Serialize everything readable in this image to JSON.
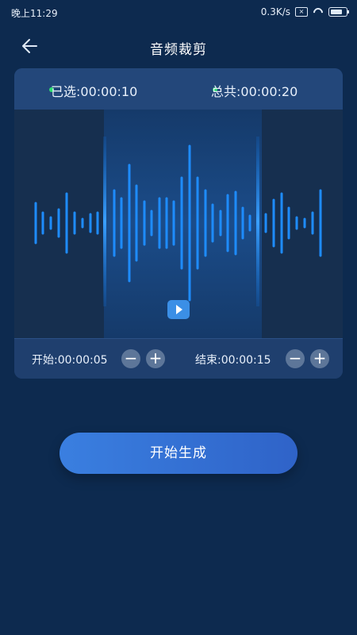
{
  "status_bar": {
    "time": "晚上11:29",
    "network_speed": "0.3K/s",
    "icons": [
      "box-icon",
      "wifi-icon",
      "battery-icon"
    ]
  },
  "header": {
    "title": "音频裁剪",
    "back_icon": "back-arrow-icon"
  },
  "trim_card": {
    "selected_text": "已选:00:00:10",
    "total_text": "总共:00:00:20",
    "play_icon": "play-icon",
    "start_text": "开始:00:00:05",
    "end_text": "结束:00:00:15",
    "minus_label": "−",
    "plus_label": "+"
  },
  "actions": {
    "generate_label": "开始生成"
  },
  "colors": {
    "background": "#0d2a4f",
    "accent": "#1e8cff",
    "indicator": "#2ee070"
  }
}
